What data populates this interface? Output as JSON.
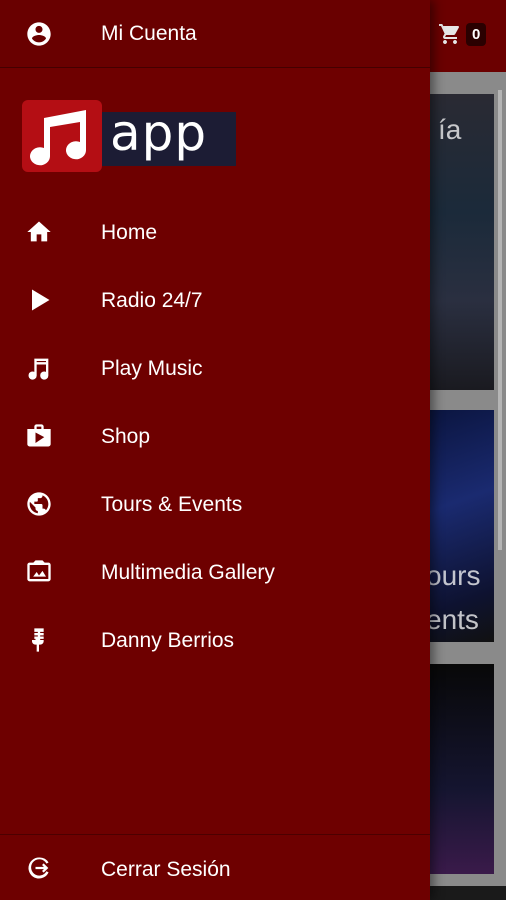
{
  "background": {
    "cart_count": "0",
    "card_texts": [
      "ía",
      "ours",
      "ents"
    ]
  },
  "account": {
    "label": "Mi Cuenta",
    "icon": "account-circle-icon"
  },
  "logo": {
    "text": "app",
    "brand_red": "#b40e14",
    "brand_dark": "#1c1c34"
  },
  "menu": {
    "items": [
      {
        "label": "Home",
        "icon": "home-icon"
      },
      {
        "label": "Radio 24/7",
        "icon": "play-icon"
      },
      {
        "label": "Play Music",
        "icon": "music-note-icon"
      },
      {
        "label": "Shop",
        "icon": "shopping-bag-icon"
      },
      {
        "label": "Tours & Events",
        "icon": "globe-icon"
      },
      {
        "label": "Multimedia Gallery",
        "icon": "gallery-icon"
      },
      {
        "label": "Danny Berrios",
        "icon": "microphone-icon"
      }
    ]
  },
  "logout": {
    "label": "Cerrar Sesión",
    "icon": "logout-icon"
  },
  "colors": {
    "drawer": "#6e0000",
    "header": "#6b0000",
    "text": "#ffffff"
  }
}
